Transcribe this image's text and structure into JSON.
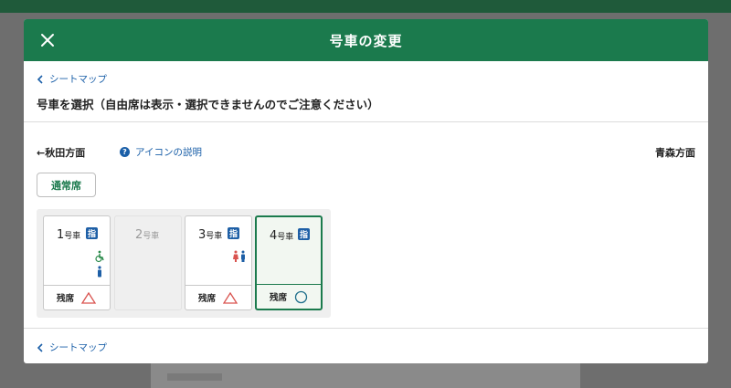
{
  "modal": {
    "title": "号車の変更",
    "back_link_top": "シートマップ",
    "heading": "号車を選択（自由席は表示・選択できませんのでご注意ください）",
    "direction_left": "←秋田方面",
    "icon_help": "アイコンの説明",
    "direction_right": "青森方面",
    "seat_class": "通常席",
    "back_link_bottom": "シートマップ"
  },
  "cars": [
    {
      "num": "1",
      "unit": "号車",
      "reserved_badge": "指",
      "remaining_label": "残席",
      "availability": "few",
      "amenities": [
        "wheelchair-icon",
        "multipurpose-icon"
      ]
    },
    {
      "num": "2",
      "unit": "号車",
      "reserved_badge": "",
      "remaining_label": "",
      "availability": "none",
      "amenities": []
    },
    {
      "num": "3",
      "unit": "号車",
      "reserved_badge": "指",
      "remaining_label": "残席",
      "availability": "few",
      "amenities": [
        "restroom-icon"
      ]
    },
    {
      "num": "4",
      "unit": "号車",
      "reserved_badge": "指",
      "remaining_label": "残席",
      "availability": "available",
      "amenities": [],
      "selected": true
    }
  ],
  "colors": {
    "header": "#1b7a4d",
    "link": "#1a5fa8",
    "badge": "#1e5fa6",
    "few": "#d9534f",
    "available": "#1f6f8b"
  }
}
